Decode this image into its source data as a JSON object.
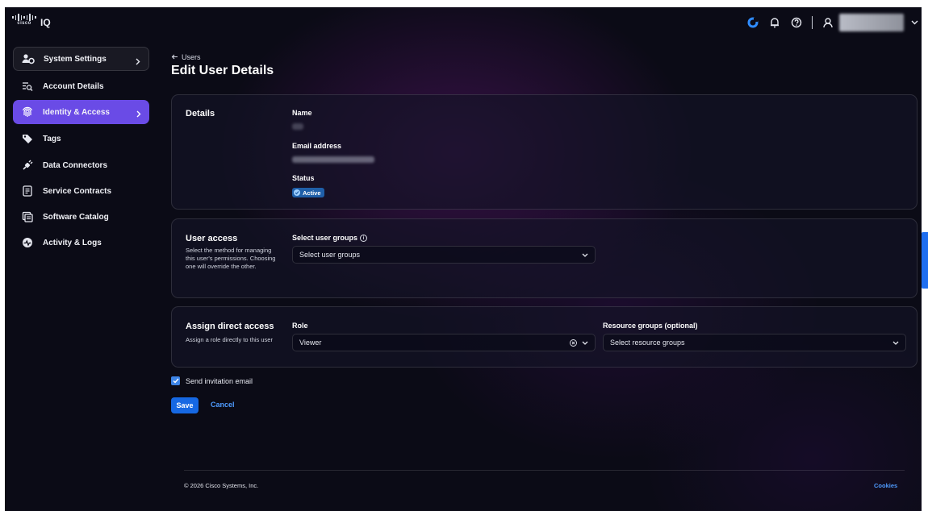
{
  "topbar": {
    "logo_text": "cisco",
    "app_name": "IQ",
    "icons": [
      "refresh-icon",
      "bell-icon",
      "help-icon",
      "user-icon",
      "chevron-down-icon"
    ]
  },
  "sidebar": {
    "items": [
      {
        "label": "System Settings",
        "icon": "users-gear-icon",
        "has_chevron": true,
        "style": "settings"
      },
      {
        "label": "Account Details",
        "icon": "account-search-icon"
      },
      {
        "label": "Identity & Access",
        "icon": "fingerprint-icon",
        "has_chevron": true,
        "style": "active"
      },
      {
        "label": "Tags",
        "icon": "tag-icon"
      },
      {
        "label": "Data Connectors",
        "icon": "plug-icon"
      },
      {
        "label": "Service Contracts",
        "icon": "contract-icon"
      },
      {
        "label": "Software Catalog",
        "icon": "catalog-icon"
      },
      {
        "label": "Activity & Logs",
        "icon": "activity-icon"
      }
    ]
  },
  "main": {
    "back_link": "Users",
    "title": "Edit User Details",
    "details": {
      "title": "Details",
      "name_label": "Name",
      "email_label": "Email address",
      "status_label": "Status",
      "status_value": "Active"
    },
    "user_access": {
      "title": "User access",
      "description": "Select the method for managing this user's permissions. Choosing one will override the other.",
      "groups_label": "Select user groups",
      "groups_placeholder": "Select user groups"
    },
    "direct_access": {
      "title": "Assign direct access",
      "description": "Assign a role directly to this user",
      "role_label": "Role",
      "role_value": "Viewer",
      "resource_label": "Resource groups (optional)",
      "resource_placeholder": "Select resource groups"
    },
    "send_invitation_label": "Send invitation email",
    "send_invitation_checked": true,
    "save_label": "Save",
    "cancel_label": "Cancel"
  },
  "footer": {
    "copyright": "© 2026 Cisco Systems, Inc.",
    "cookies": "Cookies"
  },
  "colors": {
    "accent_active": "#6a4be6",
    "primary_button": "#1668e3",
    "link": "#4f9cff",
    "background": "#0b0b16"
  }
}
